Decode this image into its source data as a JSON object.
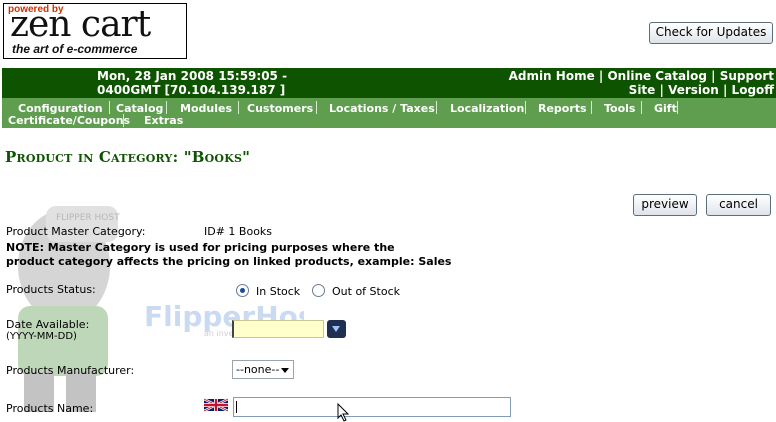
{
  "header": {
    "logo_powered": "powered by",
    "logo_brand": "zen cart",
    "logo_tagline": "the art of e-commerce",
    "check_updates_label": "Check for Updates"
  },
  "topbar": {
    "datetime_line1": "Mon, 28 Jan 2008 15:59:05 -",
    "datetime_line2": "0400GMT [70.104.139.187 ]",
    "links": [
      "Admin Home",
      "Online Catalog",
      "Support Site",
      "Version",
      "Logoff"
    ]
  },
  "menu": {
    "items": [
      "Configuration",
      "Catalog",
      "Modules",
      "Customers",
      "Locations / Taxes",
      "Localization",
      "Reports",
      "Tools",
      "Gift Certificate/Coupons",
      "Extras"
    ]
  },
  "page": {
    "title": "Product in Category: \"Books\"",
    "preview_label": "preview",
    "cancel_label": "cancel",
    "master_category_label": "Product Master Category:",
    "master_category_value": "ID# 1 Books",
    "note_line1": "NOTE: Master Category is used for pricing purposes where the",
    "note_line2": "product category affects the pricing on linked products, example: Sales",
    "status_label": "Products Status:",
    "status_options": [
      "In Stock",
      "Out of Stock"
    ],
    "status_selected": "In Stock",
    "date_label": "Date Available:",
    "date_format": "(YYYY-MM-DD)",
    "date_value": "",
    "manufacturer_label": "Products Manufacturer:",
    "manufacturer_value": "--none--",
    "name_label": "Products Name:",
    "name_value": ""
  },
  "watermark": {
    "brand": "FlipperHost",
    "tagline": "an invest tion company",
    "badge": "FLIPPER HOST"
  },
  "colors": {
    "topbar_bg": "#0d5300",
    "menubar_bg": "#5f9e4f",
    "title_color": "#0d5300",
    "date_input_bg": "#ffffcc"
  }
}
